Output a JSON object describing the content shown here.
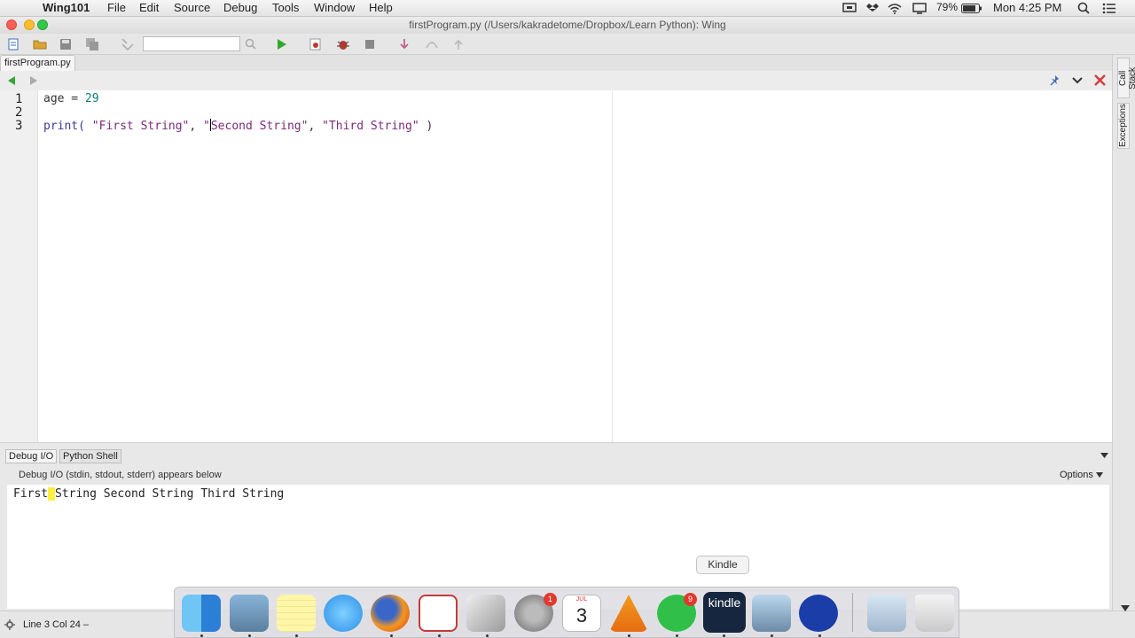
{
  "menubar": {
    "app_name": "Wing101",
    "items": [
      "File",
      "Edit",
      "Source",
      "Debug",
      "Tools",
      "Window",
      "Help"
    ],
    "battery": "79%",
    "clock": "Mon 4:25 PM"
  },
  "window": {
    "title": "firstProgram.py (/Users/kakradetome/Dropbox/Learn Python): Wing"
  },
  "toolbar": {
    "search_value": ""
  },
  "editor": {
    "tab_label": "firstProgram.py",
    "line_numbers": [
      "1",
      "2",
      "3"
    ],
    "line1": {
      "name": "age",
      "op": " = ",
      "num": "29"
    },
    "line3": {
      "fn": "print( ",
      "s1": "\"First String\"",
      "sep1": ", ",
      "q": "\"",
      "s2rest": "Second String\"",
      "sep2": ", ",
      "s3": "\"Third String\"",
      "close": " )"
    }
  },
  "side_tabs": [
    "Call Stack",
    "Exceptions"
  ],
  "lower": {
    "tabs": [
      "Debug I/O",
      "Python Shell"
    ],
    "description": "Debug I/O (stdin, stdout, stderr) appears below",
    "options_label": "Options",
    "output_pre": "First",
    "output_hl": " ",
    "output_post": "String Second String Third String"
  },
  "status": {
    "text": "Line 3 Col 24 –"
  },
  "dock": {
    "tooltip": "Kindle",
    "calendar_month": "JUL",
    "calendar_day": "3",
    "kindle_label": "kindle",
    "badges": {
      "system_prefs": "1",
      "whatsapp": "9"
    }
  },
  "colors": {
    "run_green": "#2fa82f",
    "debug_red": "#c0392b",
    "close_red": "#d33b3b",
    "highlight": "#ffee44"
  }
}
